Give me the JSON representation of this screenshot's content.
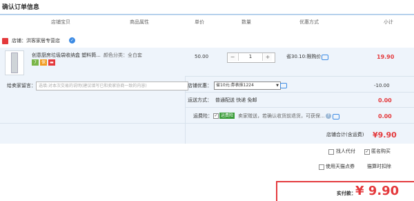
{
  "page_title": "确认订单信息",
  "columns": [
    "店铺宝贝",
    "商品属性",
    "单价",
    "数量",
    "优惠方式",
    "小计"
  ],
  "shop": {
    "label": "店铺：",
    "name": "洪客家居专营店"
  },
  "item": {
    "name": "创意厨房垃圾袋收纳盒 塑料筒...",
    "attr": "颜色分类：全白套",
    "price": "50.00",
    "quantity": "1",
    "discount": "省30.10:限购价",
    "subtotal": "19.90"
  },
  "message": {
    "label": "给卖家留言：",
    "placeholder": "选填:对本次交易的说明(建议填写已和卖家协商一致的内容)"
  },
  "shop_coupon": {
    "label": "店铺优惠：",
    "selected": "省10元:券表抹1224",
    "value": "-10.00"
  },
  "shipping": {
    "label": "运送方式：",
    "value": "普通配送 快递 免邮",
    "amount": "0.00"
  },
  "insurance": {
    "label": "运费险：",
    "tag": "运费险",
    "text": "卖家赠送，若确认收货前退货，可获保...",
    "amount": "0.00"
  },
  "shop_total": {
    "label": "店铺合计(含运费)",
    "value": "¥9.90"
  },
  "options": {
    "proxy_pay": "找人代付",
    "anonymous": "匿名购买",
    "tmall_points": "使用天猫点券",
    "points_deduct": "猫算时扣除"
  },
  "payment": {
    "label": "实付款：",
    "value": "¥ 9.90"
  },
  "colors": {
    "accent": "#e4393c",
    "header_line": "#b6d1ec",
    "row_bg": "#eef4fb",
    "tag_green": "#3a9d3a"
  }
}
